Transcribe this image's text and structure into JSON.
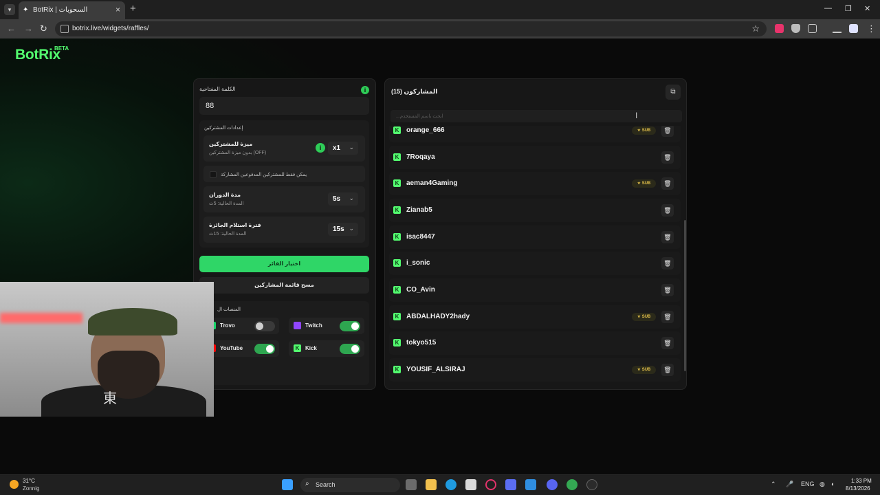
{
  "browser": {
    "tab_title": "BotRix | السحوبات",
    "url": "botrix.live/widgets/raffles/"
  },
  "brand": {
    "name": "BotRix",
    "badge": "BETA",
    "color": "#53fc6f"
  },
  "raffle_form": {
    "keyword_label": "الكلمة المفتاحية",
    "keyword_value": "88",
    "settings_title": "إعدادات المشتركين",
    "subscriber_perk": {
      "title": "ميزة للمشتركين",
      "subtitle": "بدون ميزة المشتركين (OFF)",
      "value": "x1"
    },
    "paid_only_label": "يمكن فقط للمشتركين المدفوعين المشاركة",
    "spin_duration": {
      "title": "مدة الدوران",
      "subtitle": "المدة الحالية: 5ث",
      "value": "5s"
    },
    "claim_period": {
      "title": "فترة استلام الجائزة",
      "subtitle": "المدة الحالية: 15ث",
      "value": "15s"
    },
    "pick_winner_label": "اختيار الفائز",
    "clear_list_label": "مسح قائمة المشاركين",
    "platforms_title": "المنصات ال",
    "platforms": [
      {
        "name": "Trovo",
        "enabled": false,
        "color": "#19d66b"
      },
      {
        "name": "Twitch",
        "enabled": true,
        "color": "#9146ff"
      },
      {
        "name": "YouTube",
        "enabled": true,
        "color": "#ff0000"
      },
      {
        "name": "Kick",
        "enabled": true,
        "color": "#53fc6f"
      }
    ]
  },
  "participants": {
    "title": "المشاركون (15)",
    "search_placeholder": "...ابحث باسم المستخدم",
    "sub_badge": "SUB",
    "items": [
      {
        "name": "orange_666",
        "sub": true
      },
      {
        "name": "7Roqaya",
        "sub": false
      },
      {
        "name": "aeman4Gaming",
        "sub": true
      },
      {
        "name": "Zianab5",
        "sub": false
      },
      {
        "name": "isac8447",
        "sub": false
      },
      {
        "name": "i_sonic",
        "sub": false
      },
      {
        "name": "CO_Avin",
        "sub": false
      },
      {
        "name": "ABDALHADY2hady",
        "sub": true
      },
      {
        "name": "tokyo515",
        "sub": false
      },
      {
        "name": "YOUSIF_ALSIRAJ",
        "sub": true
      }
    ]
  },
  "webcam": {
    "shirt_glyph": "東"
  },
  "taskbar": {
    "weather_temp": "31°C",
    "weather_cond": "Zonnig",
    "search_label": "Search",
    "lang": "ENG",
    "time": "1:33 PM",
    "date": "8/13/2026"
  }
}
